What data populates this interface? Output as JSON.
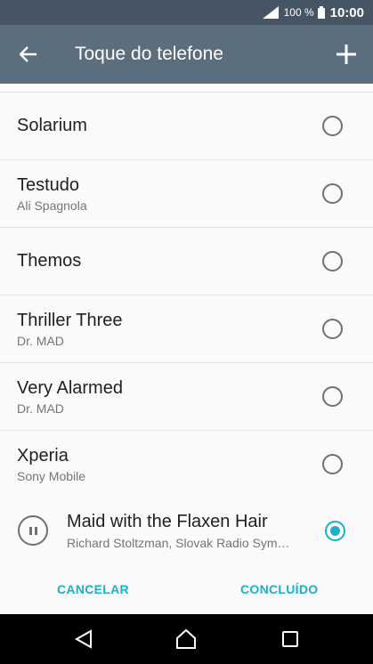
{
  "status_bar": {
    "battery_percent": "100 %",
    "time": "10:00",
    "signal_icon": "signal-icon",
    "battery_icon": "battery-icon"
  },
  "app_bar": {
    "title": "Toque do telefone",
    "back_icon": "arrow-back-icon",
    "add_icon": "plus-icon"
  },
  "ringtones": [
    {
      "name": "Solarium",
      "artist": "",
      "selected": false
    },
    {
      "name": "Testudo",
      "artist": "Ali Spagnola",
      "selected": false
    },
    {
      "name": "Themos",
      "artist": "",
      "selected": false
    },
    {
      "name": "Thriller Three",
      "artist": "Dr. MAD",
      "selected": false
    },
    {
      "name": "Very Alarmed",
      "artist": "Dr. MAD",
      "selected": false
    },
    {
      "name": "Xperia",
      "artist": "Sony Mobile",
      "selected": false
    }
  ],
  "now_playing": {
    "name": "Maid with the Flaxen Hair",
    "artist": "Richard Stoltzman, Slovak Radio Sym…",
    "selected": true,
    "control_icon": "pause-icon"
  },
  "actions": {
    "cancel_label": "CANCELAR",
    "done_label": "CONCLUÍDO"
  },
  "colors": {
    "status_bar": "#455563",
    "app_bar": "#5b6e7e",
    "accent": "#18b2c8"
  }
}
